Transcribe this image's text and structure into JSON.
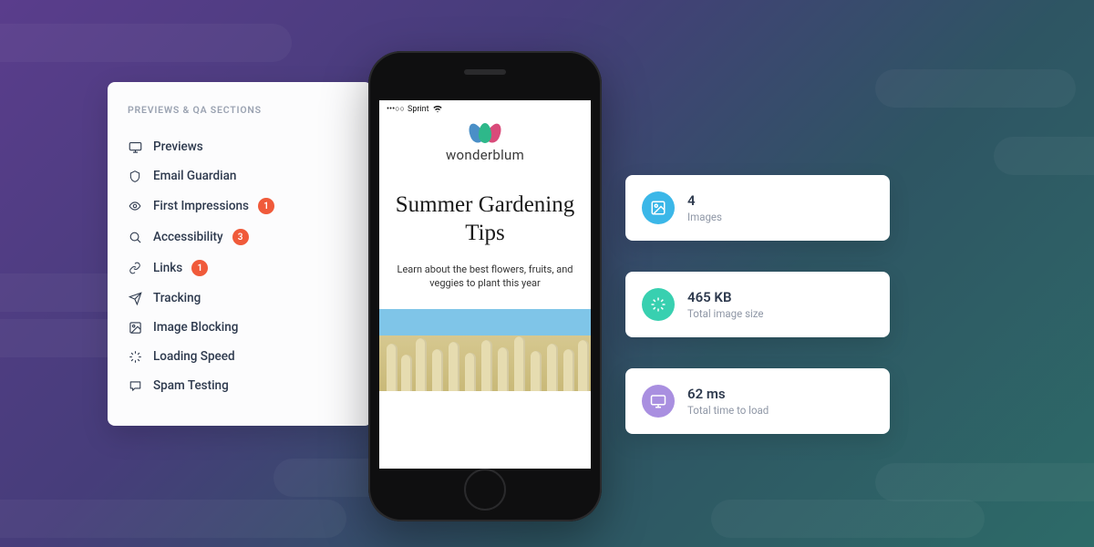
{
  "sidebar": {
    "heading": "PREVIEWS & QA SECTIONS",
    "items": [
      {
        "label": "Previews",
        "badge": null
      },
      {
        "label": "Email Guardian",
        "badge": null
      },
      {
        "label": "First Impressions",
        "badge": "1"
      },
      {
        "label": "Accessibility",
        "badge": "3"
      },
      {
        "label": "Links",
        "badge": "1"
      },
      {
        "label": "Tracking",
        "badge": null
      },
      {
        "label": "Image Blocking",
        "badge": null
      },
      {
        "label": "Loading Speed",
        "badge": null
      },
      {
        "label": "Spam Testing",
        "badge": null
      }
    ]
  },
  "phone": {
    "status_carrier": "Sprint",
    "brand_name": "wonderblum",
    "email_title": "Summer Gardening Tips",
    "email_subtitle": "Learn about the best flowers, fruits, and veggies to plant this year"
  },
  "stats": [
    {
      "value": "4",
      "label": "Images",
      "color": "#3bb7e8"
    },
    {
      "value": "465 KB",
      "label": "Total image size",
      "color": "#38d0b0"
    },
    {
      "value": "62 ms",
      "label": "Total time to load",
      "color": "#a98fe0"
    }
  ]
}
